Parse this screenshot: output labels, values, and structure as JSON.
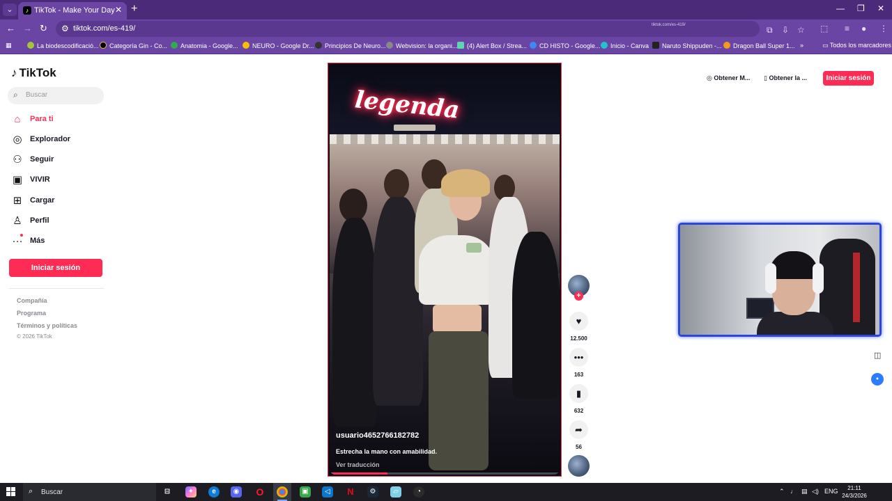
{
  "browser": {
    "tab_title": "TikTok - Make Your Day",
    "url": "tiktok.com/es-419/",
    "faint_text": "tiktok.com/es-419/",
    "bookmarks": [
      "La biodescodificació...",
      "Categoría Gin - Co...",
      "Anatomia - Google...",
      "NEURO - Google Dr...",
      "Principios De Neuro...",
      "Webvision: la organi...",
      "(4) Alert Box / Strea...",
      "CD HISTO - Google...",
      "Inicio - Canva",
      "Naruto Shippuden -...",
      "Dragon Ball Super 1..."
    ],
    "more_bookmarks": "»",
    "all_bookmarks": "Todos los marcadores"
  },
  "tiktok": {
    "logo": "TikTok",
    "search_placeholder": "Buscar",
    "nav": [
      {
        "label": "Para ti",
        "icon": "home-icon"
      },
      {
        "label": "Explorador",
        "icon": "compass-icon"
      },
      {
        "label": "Seguir",
        "icon": "follow-icon"
      },
      {
        "label": "VIVIR",
        "icon": "live-icon"
      },
      {
        "label": "Cargar",
        "icon": "upload-icon"
      },
      {
        "label": "Perfil",
        "icon": "profile-icon"
      },
      {
        "label": "Más",
        "icon": "more-icon"
      }
    ],
    "login_button": "Iniciar sesión",
    "footer": [
      "Compañía",
      "Programa",
      "Términos y políticas"
    ],
    "copyright": "© 2026 TikTok",
    "video": {
      "neon_sign": "legenda",
      "username": "usuario4652766182782",
      "description": "Estrecha la mano con amabilidad.",
      "translate": "Ver traducción",
      "progress": 0.25
    },
    "actions": {
      "likes": "12.500",
      "comments": "163",
      "saves": "632",
      "shares": "56"
    },
    "top_right": {
      "get_coins": "Obtener M...",
      "get_app": "Obtener la ...",
      "login": "Iniciar sesión"
    }
  },
  "taskbar": {
    "search_placeholder": "Buscar",
    "lang": "ENG",
    "time": "21:11",
    "date": "24/3/2026"
  },
  "colors": {
    "accent": "#fe2c55",
    "browser_frame": "#6a45a3",
    "webcam_border": "#2b46d9"
  }
}
